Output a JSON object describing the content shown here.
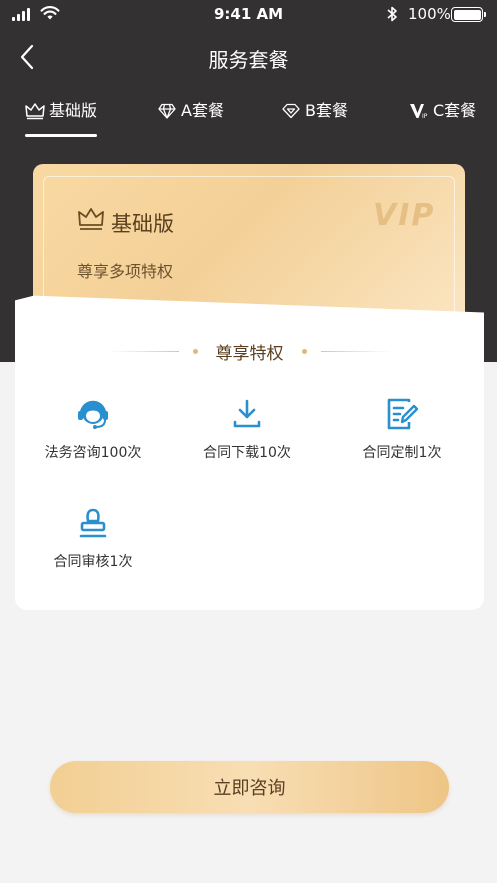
{
  "status_bar": {
    "time": "9:41 AM",
    "battery": "100%"
  },
  "header": {
    "title": "服务套餐",
    "back_icon": "chevron-left-icon"
  },
  "tabs": [
    {
      "label": "基础版",
      "icon": "crown-icon",
      "active": true
    },
    {
      "label": "A套餐",
      "icon": "diamond-icon",
      "active": false
    },
    {
      "label": "B套餐",
      "icon": "gem-icon",
      "active": false
    },
    {
      "label": "C套餐",
      "icon": "vip-icon",
      "active": false
    }
  ],
  "card": {
    "title": "基础版",
    "subtitle": "尊享多项特权",
    "watermark": "VIP"
  },
  "privileges": {
    "title": "尊享特权",
    "items": [
      {
        "label": "法务咨询100次",
        "icon": "customer-service-icon"
      },
      {
        "label": "合同下载10次",
        "icon": "download-icon"
      },
      {
        "label": "合同定制1次",
        "icon": "edit-document-icon"
      },
      {
        "label": "合同审核1次",
        "icon": "stamp-icon"
      }
    ]
  },
  "consult_button": {
    "label": "立即咨询"
  },
  "colors": {
    "dark_bg": "#333132",
    "gold": "#f3d097",
    "icon_blue": "#2a8fcf",
    "text_brown": "#5a4020"
  }
}
